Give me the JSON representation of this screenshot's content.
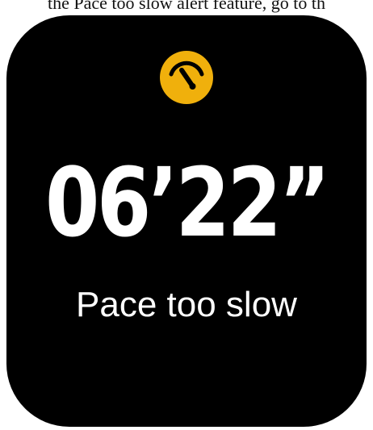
{
  "caption": {
    "text": "the Pace too slow alert feature, go to th"
  },
  "watch": {
    "icon": "speedometer-gauge-icon",
    "icon_color": "#F0B00C",
    "background_color": "#000000",
    "pace_value": "06’22”",
    "alert_label": "Pace too slow"
  }
}
